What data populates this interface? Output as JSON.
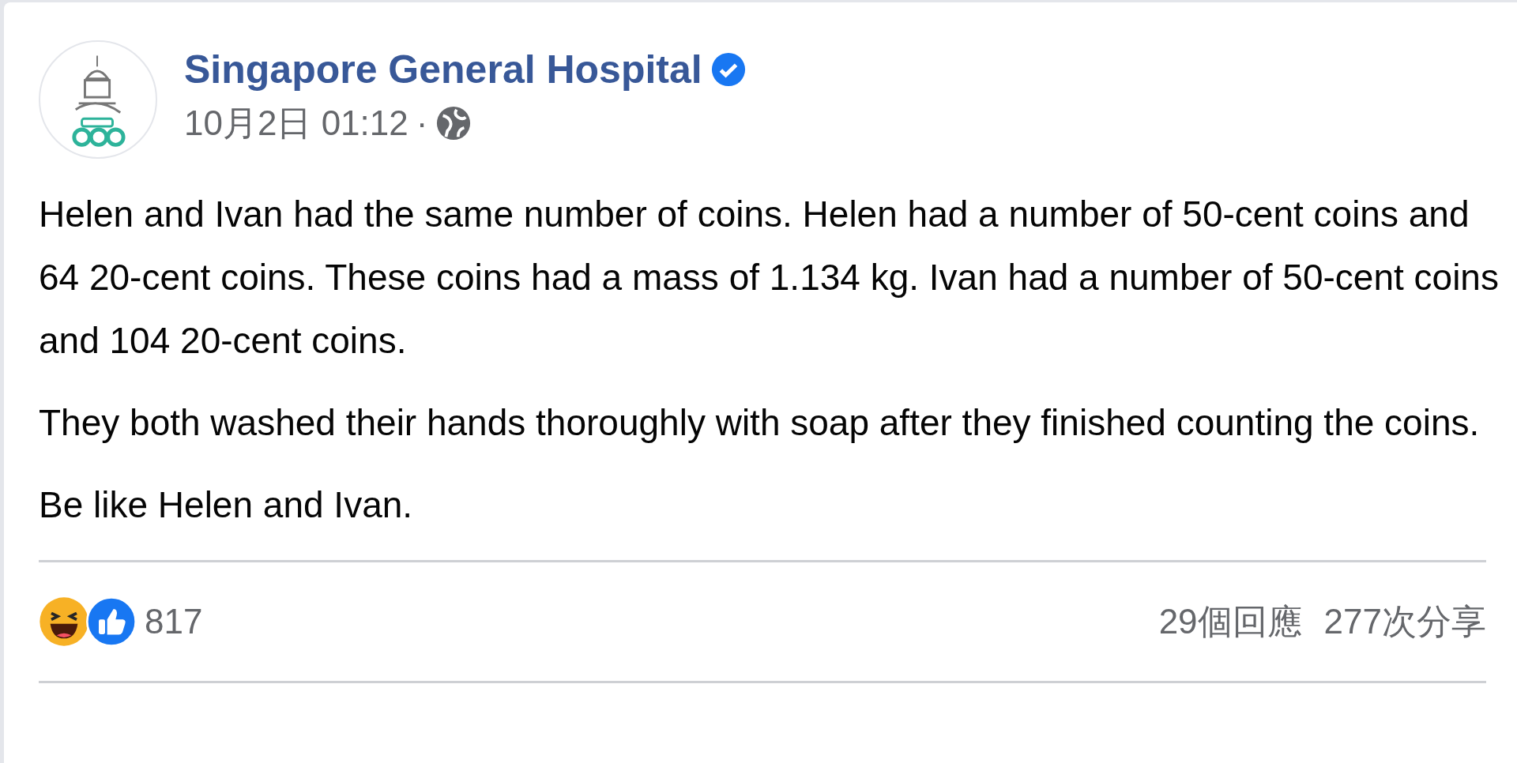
{
  "post": {
    "author": "Singapore General Hospital",
    "verified": true,
    "timestamp": "10月2日 01:12",
    "separator": "·",
    "paragraphs": [
      "Helen and Ivan had the same number of coins. Helen had a number of 50-cent coins and 64 20-cent coins. These coins had a mass of 1.134 kg. Ivan had a number of 50-cent coins and 104 20-cent coins.",
      "They both washed their hands thoroughly with soap after they finished counting the coins.",
      "Be like Helen and Ivan."
    ],
    "reaction_count": "817",
    "comments": "29個回應",
    "shares": "277次分享"
  }
}
